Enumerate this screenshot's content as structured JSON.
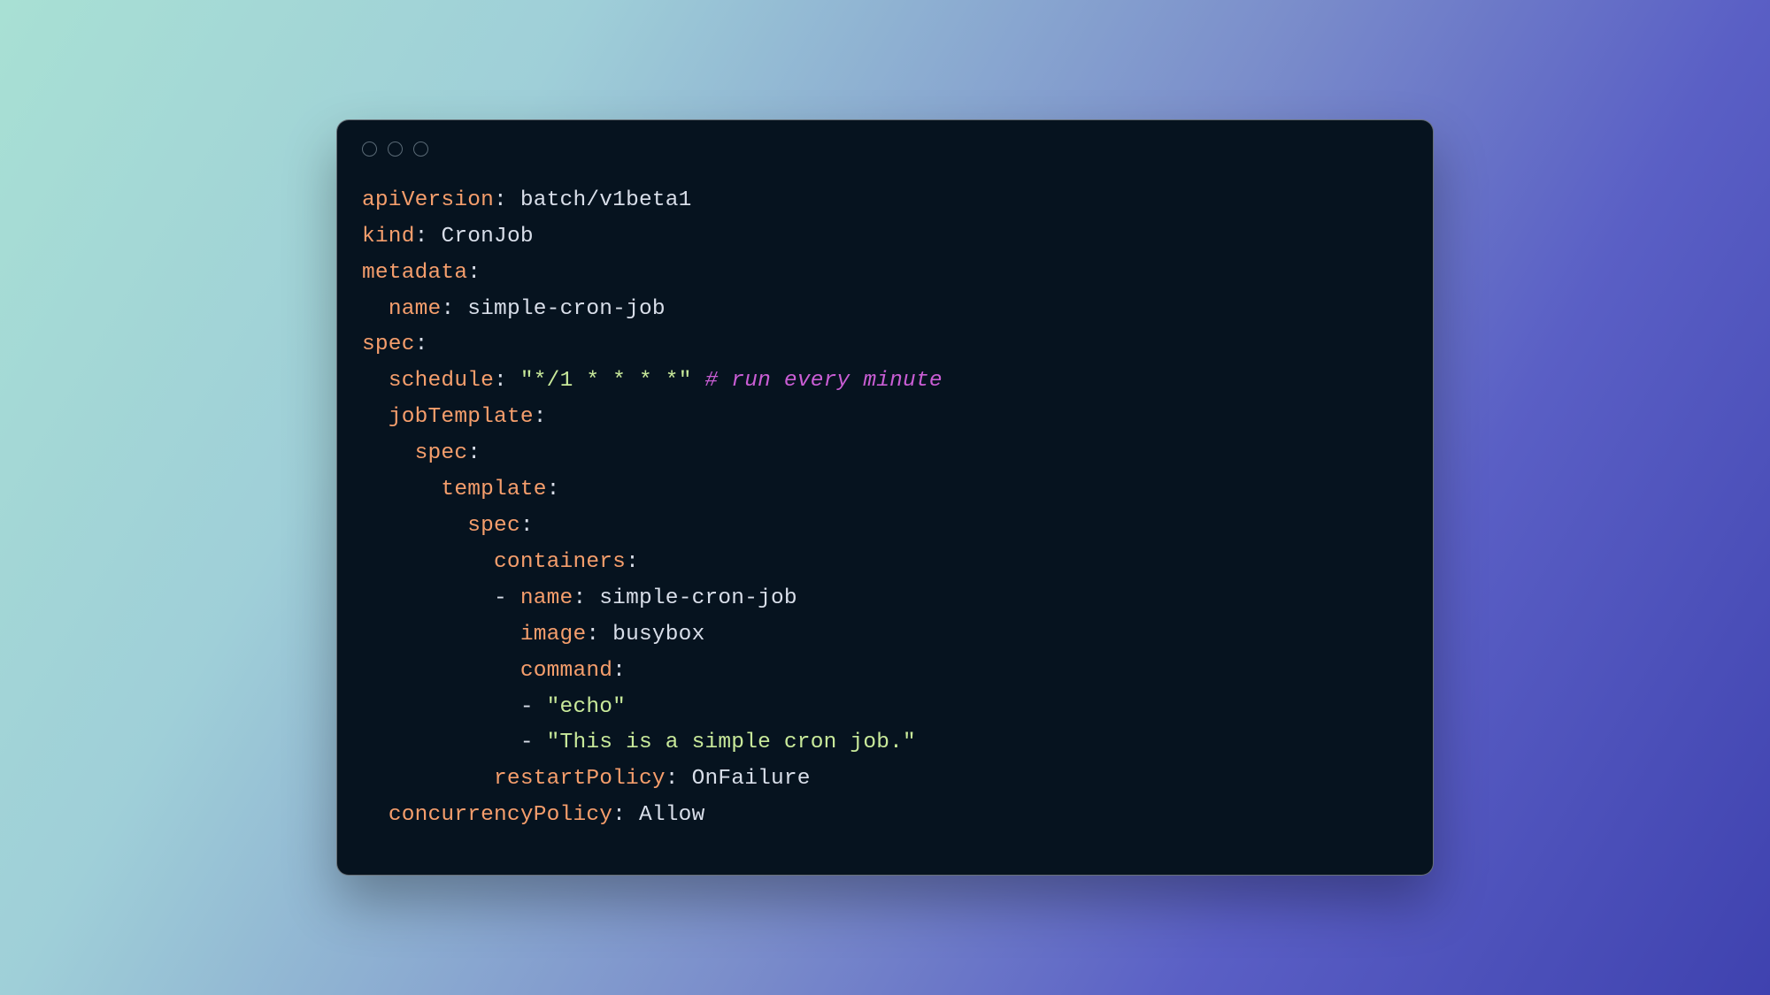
{
  "code": {
    "line1_key": "apiVersion",
    "line1_val": "batch/v1beta1",
    "line2_key": "kind",
    "line2_val": "CronJob",
    "line3_key": "metadata",
    "line4_key": "name",
    "line4_val": "simple-cron-job",
    "line5_key": "spec",
    "line6_key": "schedule",
    "line6_str": "\"*/1 * * * *\"",
    "line6_com": "# run every minute",
    "line7_key": "jobTemplate",
    "line8_key": "spec",
    "line9_key": "template",
    "line10_key": "spec",
    "line11_key": "containers",
    "line12_dash": "-",
    "line12_key": "name",
    "line12_val": "simple-cron-job",
    "line13_key": "image",
    "line13_val": "busybox",
    "line14_key": "command",
    "line15_dash": "-",
    "line15_str": "\"echo\"",
    "line16_dash": "-",
    "line16_str": "\"This is a simple cron job.\"",
    "line17_key": "restartPolicy",
    "line17_val": "OnFailure",
    "line18_key": "concurrencyPolicy",
    "line18_val": "Allow",
    "colon": ":",
    "space": " "
  }
}
